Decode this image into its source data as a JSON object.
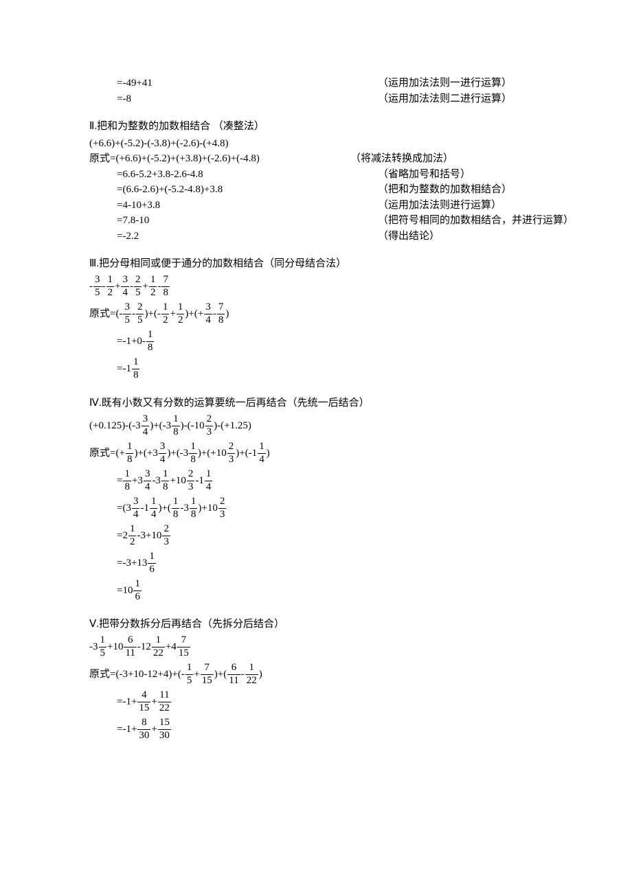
{
  "section1": {
    "steps": [
      {
        "left": "=-49+41",
        "right": "（运用加法法则一进行运算）"
      },
      {
        "left": "=-8",
        "right": "（运用加法法则二进行运算）"
      }
    ]
  },
  "section2": {
    "title": "Ⅱ.把和为整数的加数相结合 （凑整法）",
    "problem": " (+6.6)+(-5.2)-(-3.8)+(-2.6)-(+4.8)",
    "prefix": "原式",
    "steps": [
      {
        "left": "=(+6.6)+(-5.2)+(+3.8)+(-2.6)+(-4.8)",
        "right": "（将减法转换成加法）"
      },
      {
        "left": "=6.6-5.2+3.8-2.6-4.8",
        "right": "（省略加号和括号）"
      },
      {
        "left": "=(6.6-2.6)+(-5.2-4.8)+3.8",
        "right": "（把和为整数的加数相结合）"
      },
      {
        "left": "=4-10+3.8",
        "right": "（运用加法法则进行运算）"
      },
      {
        "left": "=7.8-10",
        "right": " （把符号相同的加数相结合，并进行运算）"
      },
      {
        "left": "=-2.2",
        "right": "（得出结论）"
      }
    ]
  },
  "section3": {
    "title": "Ⅲ.把分母相同或便于通分的加数相结合（同分母结合法）",
    "prefix": "原式",
    "problem_fracs": [
      {
        "pre": "-",
        "n": "3",
        "d": "5"
      },
      {
        "pre": "-",
        "n": "1",
        "d": "2"
      },
      {
        "pre": "+",
        "n": "3",
        "d": "4"
      },
      {
        "pre": "-",
        "n": "2",
        "d": "5"
      },
      {
        "pre": "+",
        "n": "1",
        "d": "2"
      },
      {
        "pre": "-",
        "n": "7",
        "d": "8"
      }
    ],
    "step1": {
      "groups": [
        {
          "open": "(-",
          "a_n": "3",
          "a_d": "5",
          "op": "-",
          "b_n": "2",
          "b_d": "5",
          "close": ")"
        },
        {
          "open": "+(-",
          "a_n": "1",
          "a_d": "2",
          "op": "+",
          "b_n": "1",
          "b_d": "2",
          "close": ")"
        },
        {
          "open": "+(+",
          "a_n": "3",
          "a_d": "4",
          "op": "-",
          "b_n": "7",
          "b_d": "8",
          "close": ")"
        }
      ]
    },
    "step2": {
      "pre": "=-1+0-",
      "n": "1",
      "d": "8"
    },
    "step3": {
      "pre": "=-1",
      "n": "1",
      "d": "8"
    }
  },
  "section4": {
    "title": "Ⅳ.既有小数又有分数的运算要统一后再结合（先统一后结合）",
    "prefix": "原式",
    "problem": [
      {
        "t": "text",
        "v": " (+0.125)-(-3"
      },
      {
        "t": "frac",
        "n": "3",
        "d": "4"
      },
      {
        "t": "text",
        "v": ")+(-3"
      },
      {
        "t": "frac",
        "n": "1",
        "d": "8"
      },
      {
        "t": "text",
        "v": ")-(-10"
      },
      {
        "t": "frac",
        "n": "2",
        "d": "3"
      },
      {
        "t": "text",
        "v": ")-(+1.25)"
      }
    ],
    "step1": [
      {
        "t": "text",
        "v": "=(+"
      },
      {
        "t": "frac",
        "n": "1",
        "d": "8"
      },
      {
        "t": "text",
        "v": ")+(+3"
      },
      {
        "t": "frac",
        "n": "3",
        "d": "4"
      },
      {
        "t": "text",
        "v": ")+(-3"
      },
      {
        "t": "frac",
        "n": "1",
        "d": "8"
      },
      {
        "t": "text",
        "v": ")+(+10"
      },
      {
        "t": "frac",
        "n": "2",
        "d": "3"
      },
      {
        "t": "text",
        "v": ")+(-1"
      },
      {
        "t": "frac",
        "n": "1",
        "d": "4"
      },
      {
        "t": "text",
        "v": ")"
      }
    ],
    "step2": [
      {
        "t": "text",
        "v": "="
      },
      {
        "t": "frac",
        "n": "1",
        "d": "8"
      },
      {
        "t": "text",
        "v": "+3"
      },
      {
        "t": "frac",
        "n": "3",
        "d": "4"
      },
      {
        "t": "text",
        "v": "-3"
      },
      {
        "t": "frac",
        "n": "1",
        "d": "8"
      },
      {
        "t": "text",
        "v": "+10"
      },
      {
        "t": "frac",
        "n": "2",
        "d": "3"
      },
      {
        "t": "text",
        "v": "-1"
      },
      {
        "t": "frac",
        "n": "1",
        "d": "4"
      }
    ],
    "step3": [
      {
        "t": "text",
        "v": "=(3"
      },
      {
        "t": "frac",
        "n": "3",
        "d": "4"
      },
      {
        "t": "text",
        "v": "-1"
      },
      {
        "t": "frac",
        "n": "1",
        "d": "4"
      },
      {
        "t": "text",
        "v": ")+("
      },
      {
        "t": "frac",
        "n": "1",
        "d": "8"
      },
      {
        "t": "text",
        "v": "-3"
      },
      {
        "t": "frac",
        "n": "1",
        "d": "8"
      },
      {
        "t": "text",
        "v": ")+10"
      },
      {
        "t": "frac",
        "n": "2",
        "d": "3"
      }
    ],
    "step4": [
      {
        "t": "text",
        "v": "=2"
      },
      {
        "t": "frac",
        "n": "1",
        "d": "2"
      },
      {
        "t": "text",
        "v": "-3+10"
      },
      {
        "t": "frac",
        "n": "2",
        "d": "3"
      }
    ],
    "step5": [
      {
        "t": "text",
        "v": "=-3+13"
      },
      {
        "t": "frac",
        "n": "1",
        "d": "6"
      }
    ],
    "step6": [
      {
        "t": "text",
        "v": "=10"
      },
      {
        "t": "frac",
        "n": "1",
        "d": "6"
      }
    ]
  },
  "section5": {
    "title": "Ⅴ.把带分数拆分后再结合（先拆分后结合）",
    "prefix": "原式",
    "problem": [
      {
        "t": "text",
        "v": "-3"
      },
      {
        "t": "frac",
        "n": "1",
        "d": "5"
      },
      {
        "t": "text",
        "v": "+10"
      },
      {
        "t": "frac",
        "n": "6",
        "d": "11"
      },
      {
        "t": "text",
        "v": "-12"
      },
      {
        "t": "frac",
        "n": "1",
        "d": "22"
      },
      {
        "t": "text",
        "v": "+4"
      },
      {
        "t": "frac",
        "n": "7",
        "d": "15"
      }
    ],
    "step1": [
      {
        "t": "text",
        "v": "=(-3+10-12+4)+(-"
      },
      {
        "t": "frac",
        "n": "1",
        "d": "5"
      },
      {
        "t": "text",
        "v": "+"
      },
      {
        "t": "frac",
        "n": "7",
        "d": "15"
      },
      {
        "t": "text",
        "v": ")+("
      },
      {
        "t": "frac",
        "n": "6",
        "d": "11"
      },
      {
        "t": "text",
        "v": "-"
      },
      {
        "t": "frac",
        "n": "1",
        "d": "22"
      },
      {
        "t": "text",
        "v": ")"
      }
    ],
    "step2": [
      {
        "t": "text",
        "v": "=-1+"
      },
      {
        "t": "frac",
        "n": "4",
        "d": "15"
      },
      {
        "t": "text",
        "v": "+"
      },
      {
        "t": "frac",
        "n": "11",
        "d": "22"
      }
    ],
    "step3": [
      {
        "t": "text",
        "v": "=-1+"
      },
      {
        "t": "frac",
        "n": "8",
        "d": "30"
      },
      {
        "t": "text",
        "v": "+"
      },
      {
        "t": "frac",
        "n": "15",
        "d": "30"
      }
    ]
  }
}
